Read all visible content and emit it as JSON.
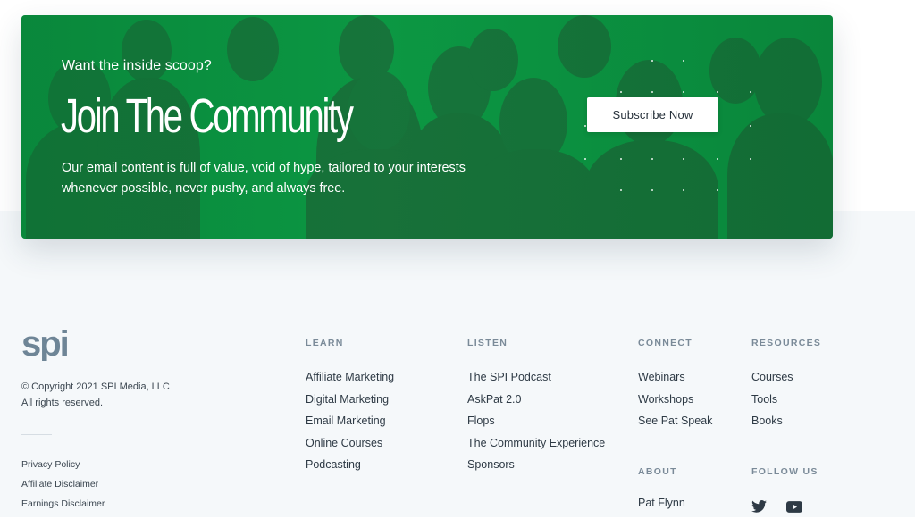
{
  "banner": {
    "kicker": "Want the inside scoop?",
    "headline": "Join The Community",
    "blurb": "Our email content is full of value, void of hype, tailored to your interests whenever possible, never pushy, and always free.",
    "cta_label": "Subscribe Now",
    "accent_color": "#0c9a44"
  },
  "footer": {
    "brand": "spi",
    "copyright_line1": "© Copyright 2021 SPI Media, LLC",
    "copyright_line2": "All rights reserved.",
    "legal_links": [
      "Privacy Policy",
      "Affiliate Disclaimer",
      "Earnings Disclaimer"
    ],
    "learn": {
      "heading": "LEARN",
      "links": [
        "Affiliate Marketing",
        "Digital Marketing",
        "Email Marketing",
        "Online Courses",
        "Podcasting"
      ]
    },
    "listen": {
      "heading": "LISTEN",
      "links": [
        "The SPI Podcast",
        "AskPat 2.0",
        "Flops",
        "The Community Experience",
        "Sponsors"
      ]
    },
    "connect": {
      "heading": "CONNECT",
      "links": [
        "Webinars",
        "Workshops",
        "See Pat Speak"
      ]
    },
    "about": {
      "heading": "ABOUT",
      "links": [
        "Pat Flynn"
      ]
    },
    "resources": {
      "heading": "RESOURCES",
      "links": [
        "Courses",
        "Tools",
        "Books"
      ]
    },
    "follow": {
      "heading": "FOLLOW US",
      "icons": [
        "twitter-icon",
        "youtube-icon"
      ]
    }
  }
}
